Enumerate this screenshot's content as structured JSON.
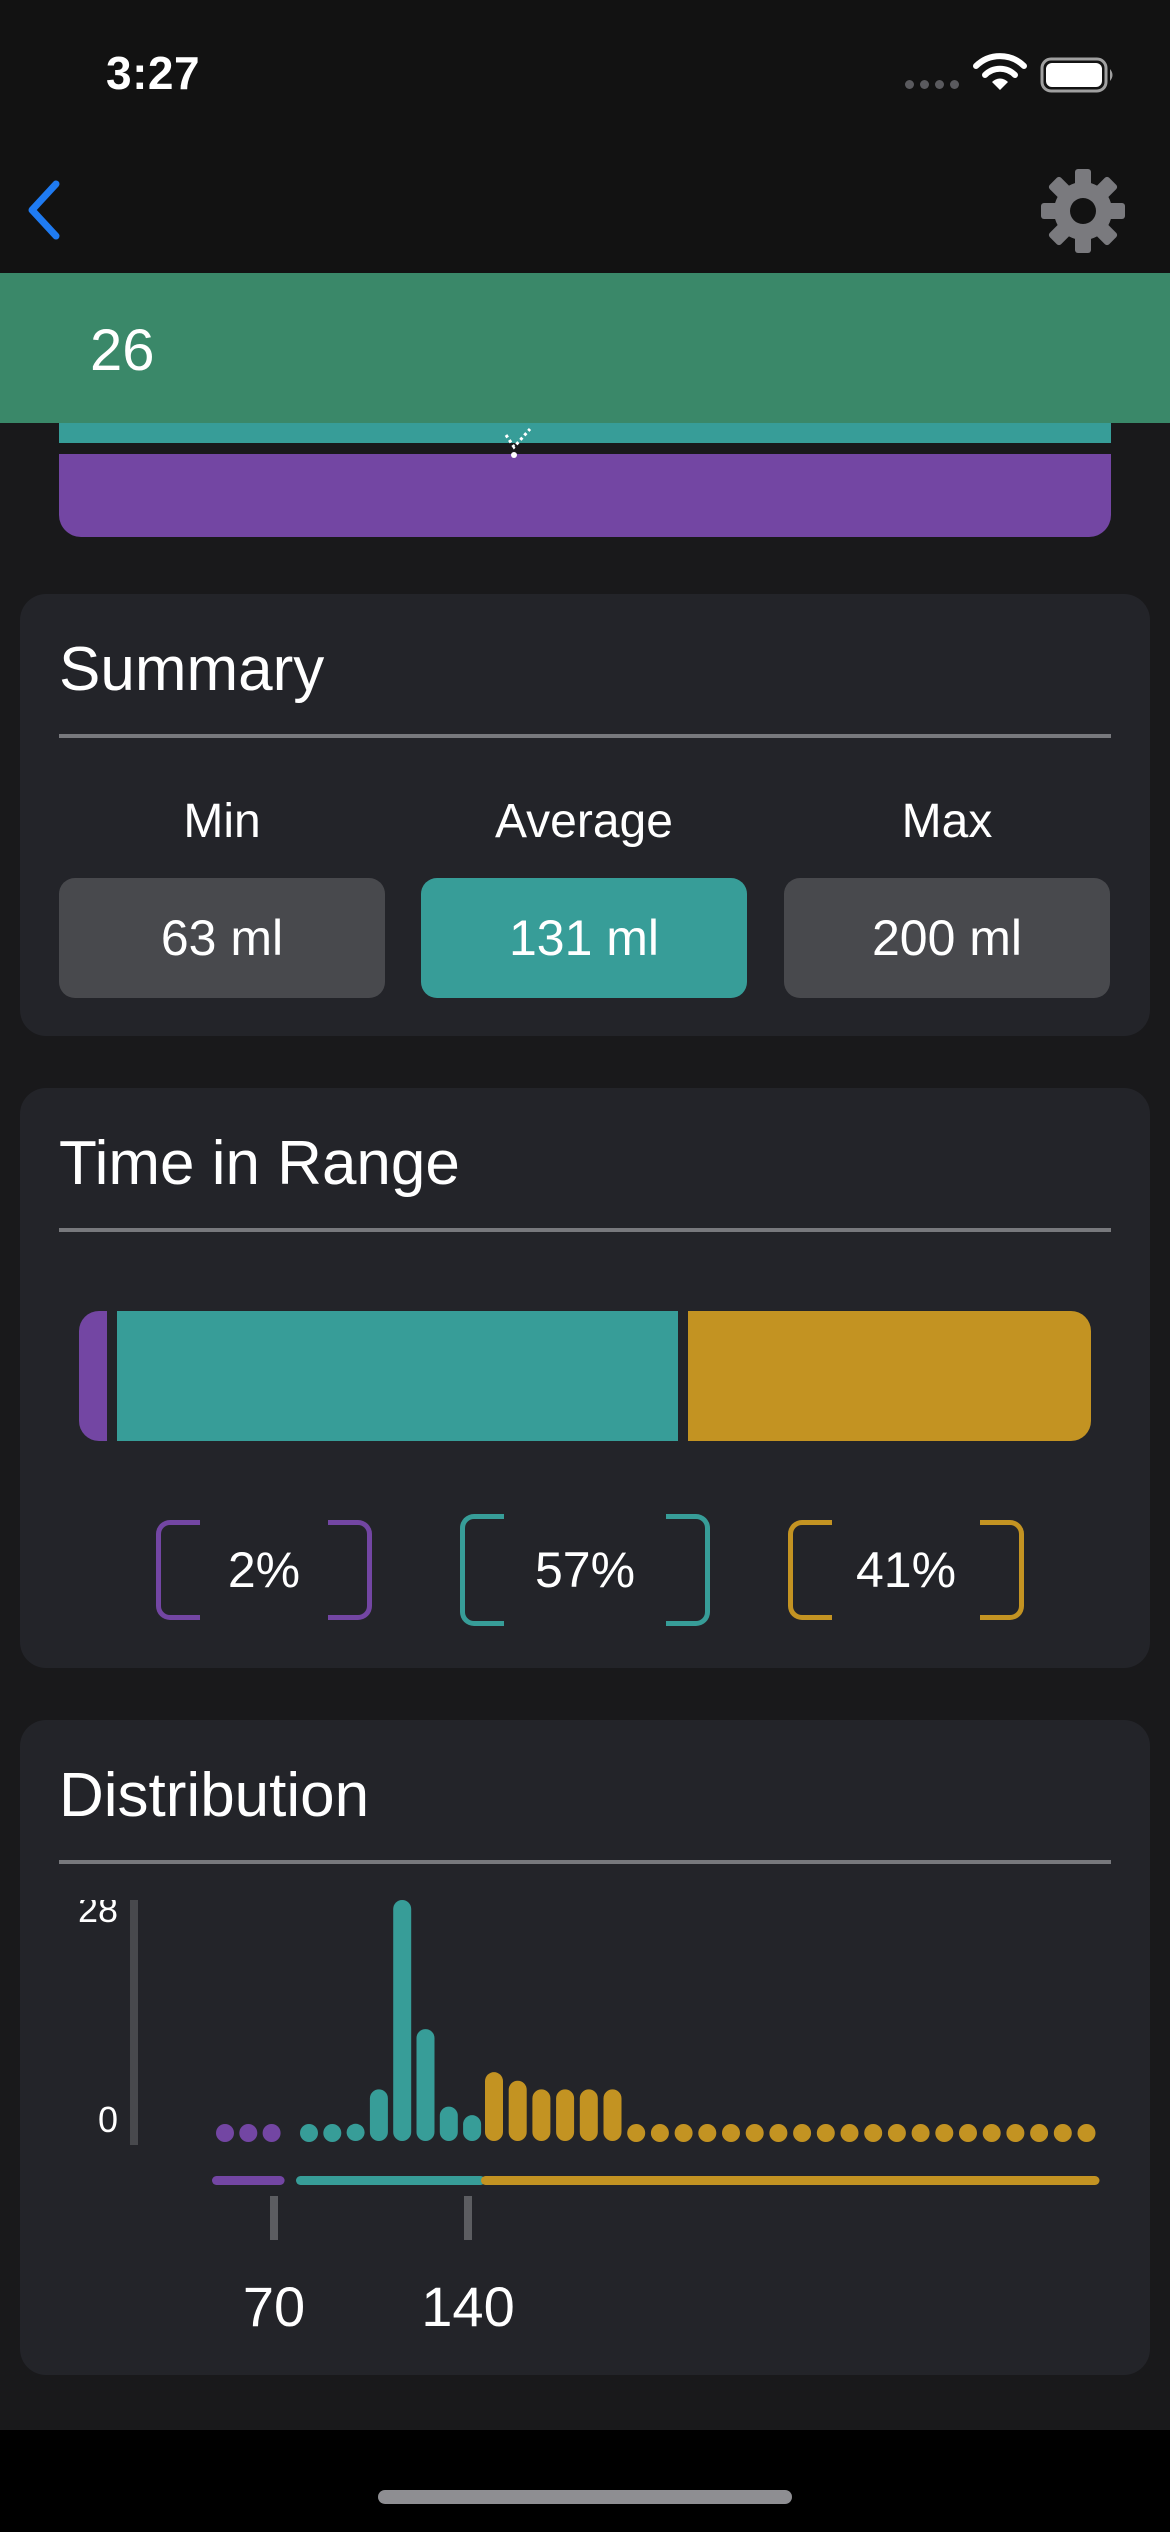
{
  "status_bar": {
    "time": "3:27"
  },
  "banner": {
    "value": "26"
  },
  "summary": {
    "title": "Summary",
    "stats": [
      {
        "label": "Min",
        "value": "63 ml"
      },
      {
        "label": "Average",
        "value": "131 ml"
      },
      {
        "label": "Max",
        "value": "200 ml"
      }
    ]
  },
  "time_in_range": {
    "title": "Time in Range",
    "segments": [
      {
        "range": "low",
        "percent": "2%",
        "color": "#7346a3"
      },
      {
        "range": "target",
        "percent": "57%",
        "color": "#379d98"
      },
      {
        "range": "high",
        "percent": "41%",
        "color": "#c39322"
      }
    ]
  },
  "distribution": {
    "title": "Distribution"
  },
  "colors": {
    "low": "#7346a3",
    "target": "#379d98",
    "high": "#c39322",
    "banner": "#3a8869",
    "card": "#232429",
    "accent_blue": "#1f7bf2"
  },
  "chart_data": {
    "type": "bar",
    "ylim": [
      0,
      28
    ],
    "y_ticks": [
      "28",
      "0"
    ],
    "x_ticks": [
      "70",
      "140"
    ],
    "threshold_ticks": [
      70,
      140
    ],
    "series": [
      {
        "range": "low",
        "color": "#7346a3",
        "values": [
          0,
          0,
          0
        ]
      },
      {
        "range": "target",
        "color": "#379d98",
        "values": [
          0,
          0,
          2,
          6,
          28,
          13,
          4,
          3
        ]
      },
      {
        "range": "high",
        "color": "#c39322",
        "values": [
          8,
          7,
          6,
          6,
          6,
          6,
          0,
          0,
          0,
          0,
          0,
          0,
          0,
          0,
          0,
          0,
          0,
          0,
          0,
          0,
          0,
          0,
          0,
          0,
          0,
          0
        ]
      }
    ]
  }
}
